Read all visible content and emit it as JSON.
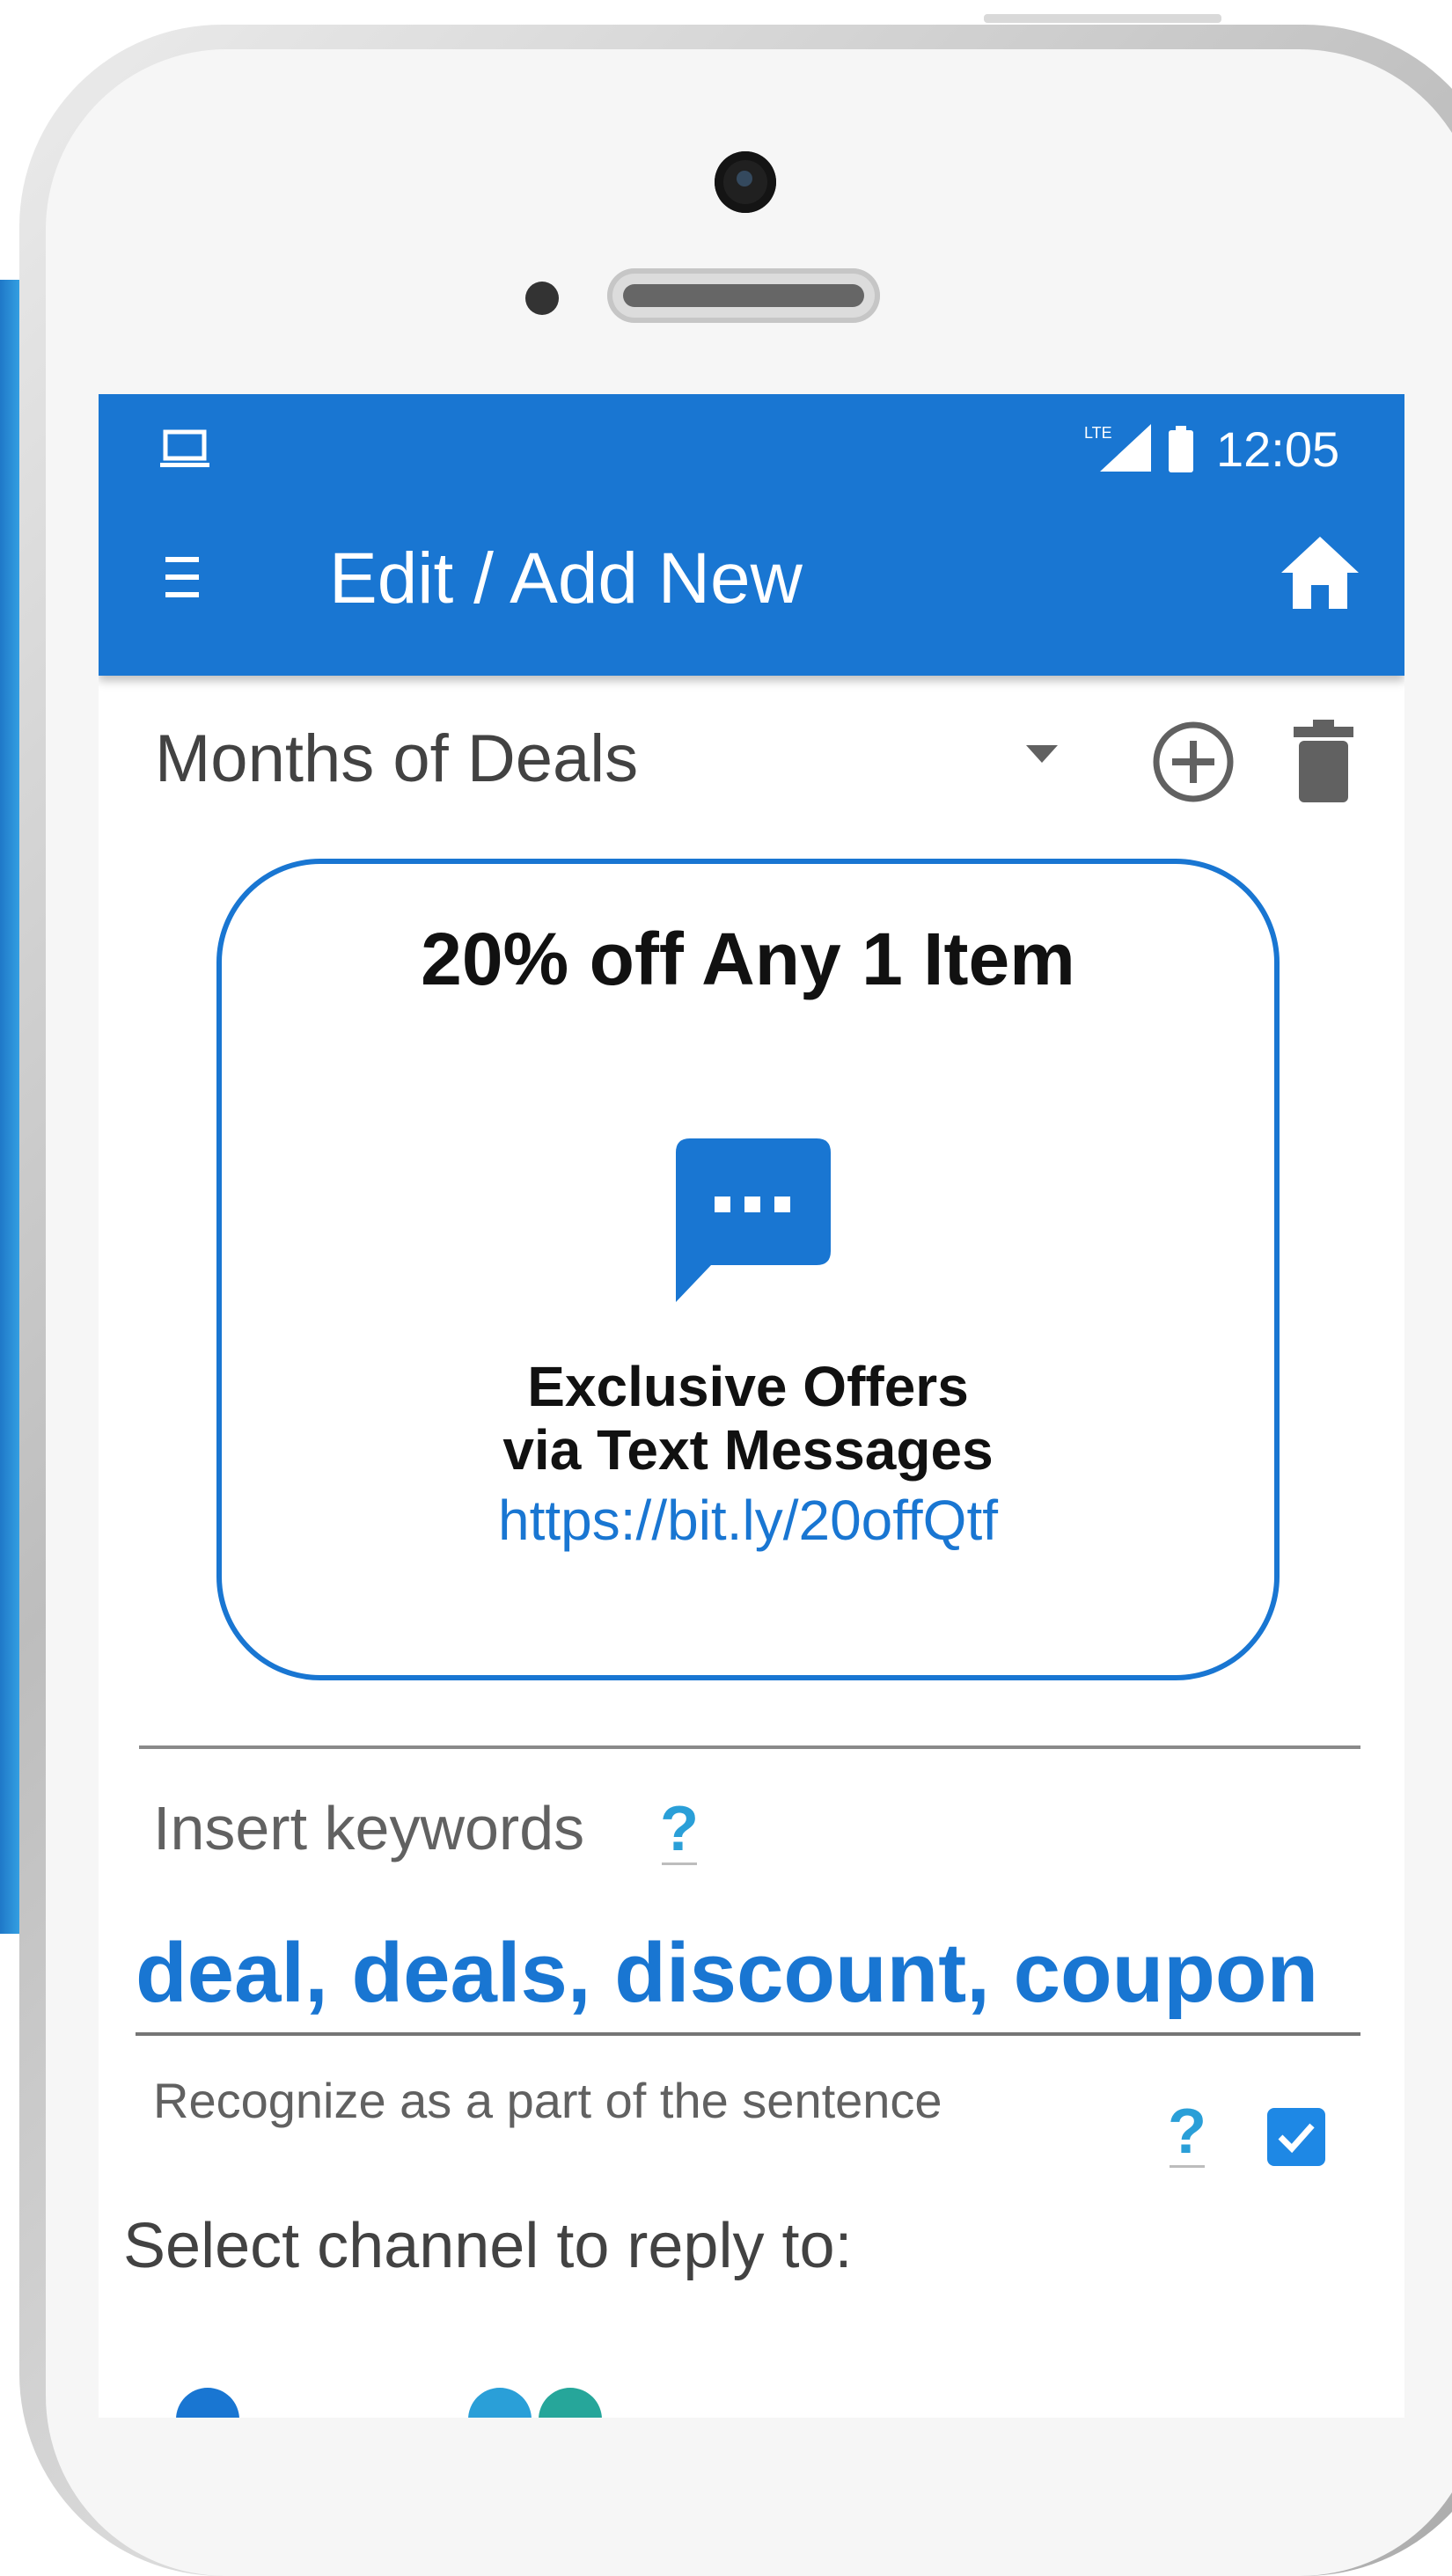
{
  "status_bar": {
    "time": "12:05",
    "network": "LTE",
    "icons": [
      "laptop-icon",
      "lte-signal-icon",
      "battery-icon"
    ]
  },
  "app_bar": {
    "title": "Edit / Add New",
    "left_icon": "menu-icon",
    "right_icon": "home-icon",
    "color": "#1976d2"
  },
  "campaign": {
    "selected": "Months of Deals",
    "dropdown_icon": "dropdown-arrow-icon",
    "actions": [
      "add-circle-icon",
      "trash-icon"
    ]
  },
  "preview": {
    "title": "20% off Any 1 Item",
    "icon": "chat-bubble-icon",
    "line1": "Exclusive Offers",
    "line2": "via Text Messages",
    "link": "https://bit.ly/20offQtf"
  },
  "keywords": {
    "label": "Insert keywords",
    "help": "?",
    "value": "deal, deals, discount, coupon",
    "sentence_option": "Recognize as a part of the sentence",
    "sentence_help": "?",
    "sentence_checked": true
  },
  "channel": {
    "label": "Select channel to reply to:"
  },
  "colors": {
    "accent": "#1976d2",
    "help": "#2a9fd8",
    "checkbox": "#1e88e5"
  }
}
